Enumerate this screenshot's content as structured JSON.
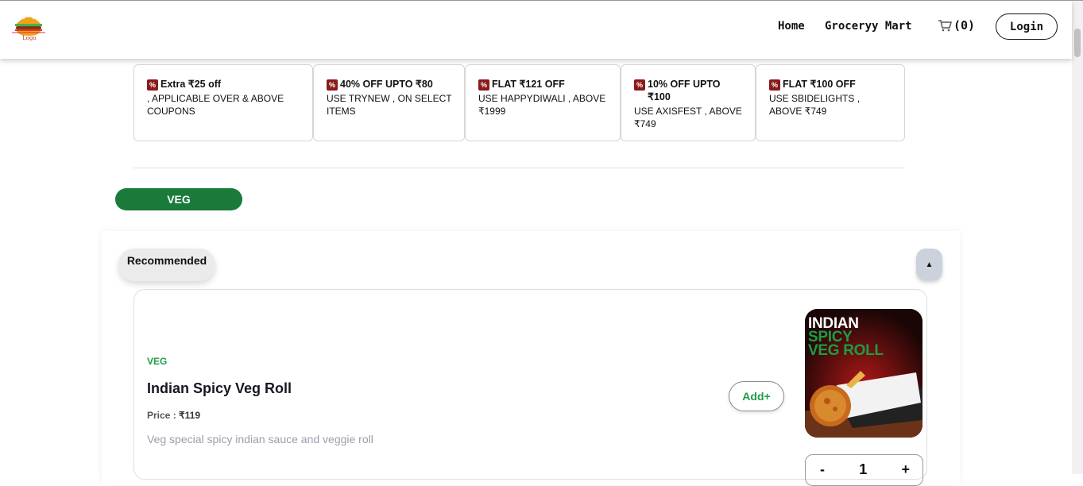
{
  "header": {
    "logo_text": "Logo",
    "nav": {
      "home": "Home",
      "grocery": "Groceryy Mart"
    },
    "cart_count": "(0)",
    "login": "Login"
  },
  "coupons": [
    {
      "title": "Extra ₹25 off",
      "desc": ", APPLICABLE OVER & ABOVE COUPONS"
    },
    {
      "title": "40% OFF UPTO ₹80",
      "desc": "USE TRYNEW , ON SELECT ITEMS"
    },
    {
      "title": "FLAT ₹121 OFF",
      "desc": "USE HAPPYDIWALI , ABOVE ₹1999"
    },
    {
      "title": "10% OFF UPTO ₹100",
      "desc": "USE AXISFEST , ABOVE ₹749"
    },
    {
      "title": "FLAT ₹100 OFF",
      "desc": "USE SBIDELIGHTS , ABOVE ₹749"
    }
  ],
  "filter": {
    "veg": "VEG"
  },
  "section": {
    "title": "Recommended",
    "collapse_glyph": "▲",
    "item": {
      "tag": "VEG",
      "name": "Indian Spicy Veg Roll",
      "price_label": "Price : ",
      "price": "₹119",
      "description": "Veg special spicy indian sauce and veggie roll",
      "add": "Add+",
      "image_title": {
        "line1": "INDIAN",
        "line2": "SPICY",
        "line3": "VEG ROLL"
      },
      "quantity": "1",
      "minus": "-",
      "plus": "+"
    }
  },
  "colors": {
    "veg_green": "#1a7a3a",
    "accent_green": "#1f9d48",
    "coupon_icon": "#8b1a1a"
  }
}
